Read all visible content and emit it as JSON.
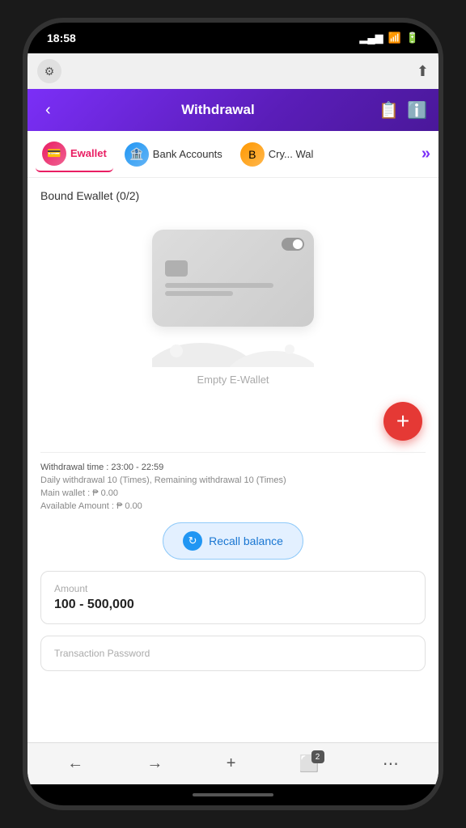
{
  "status_bar": {
    "time": "18:58",
    "signal": "▂▄▆",
    "wifi": "WiFi",
    "battery": "🔋"
  },
  "top_nav": {
    "back_label": "‹",
    "title": "Withdrawal",
    "icon_add": "📋",
    "icon_info": "ℹ"
  },
  "tabs": [
    {
      "id": "ewallet",
      "label": "Ewallet",
      "icon": "💳",
      "icon_type": "pink",
      "active": true
    },
    {
      "id": "bank",
      "label": "Bank Accounts",
      "icon": "🏦",
      "icon_type": "blue",
      "active": false
    },
    {
      "id": "crypto",
      "label": "Cry... Wal",
      "icon": "B",
      "icon_type": "orange",
      "active": false
    }
  ],
  "tab_more": "»",
  "section": {
    "title": "Bound Ewallet (0/2)"
  },
  "empty_card": {
    "label": "Empty E-Wallet"
  },
  "fab": {
    "label": "+"
  },
  "info": {
    "withdrawal_time_label": "Withdrawal time :",
    "withdrawal_time_value": "23:00 - 22:59",
    "daily_withdrawal": "Daily withdrawal 10 (Times), Remaining withdrawal 10 (Times)",
    "main_wallet": "Main wallet : ₱ 0.00",
    "available_amount": "Available Amount : ₱ 0.00"
  },
  "recall_button": {
    "label": "Recall balance",
    "icon": "↻"
  },
  "amount_card": {
    "label": "Amount",
    "value": "100 - 500,000"
  },
  "transaction_card": {
    "label": "Transaction Password"
  },
  "bottom_nav": {
    "back": "←",
    "forward": "→",
    "new_tab": "+",
    "tab_count": "2",
    "menu": "⋯"
  }
}
